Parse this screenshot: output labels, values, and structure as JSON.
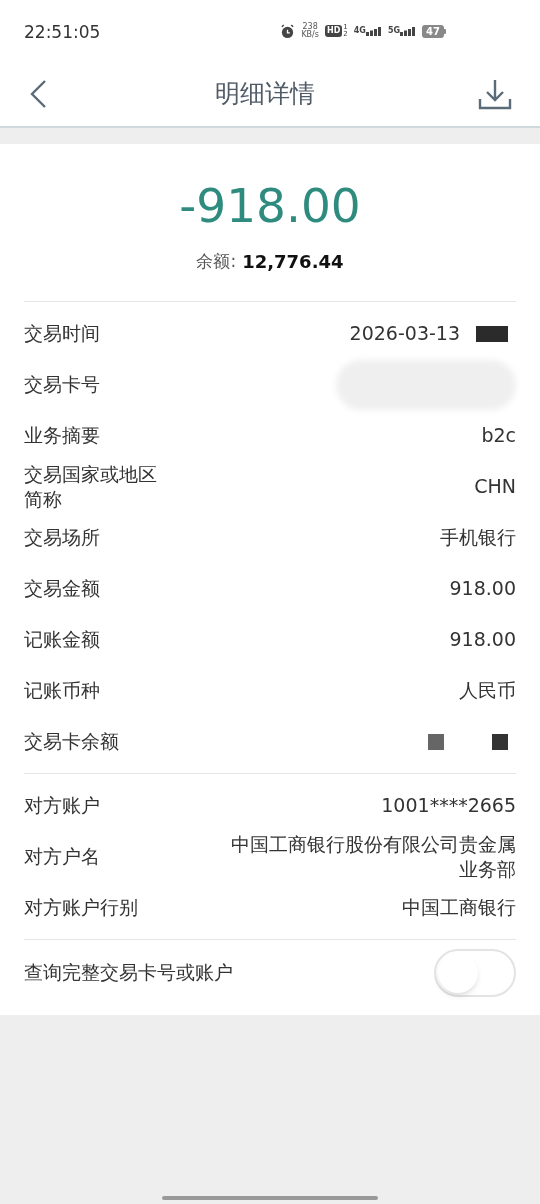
{
  "status_bar": {
    "time": "22:51:05",
    "speed": "238",
    "speed_unit": "KB/s",
    "hd": "HD",
    "sim_1": "1",
    "sim_2": "2",
    "net_1": "4G",
    "net_2": "5G",
    "battery": "47"
  },
  "header": {
    "title": "明细详情"
  },
  "summary": {
    "amount": "-918.00",
    "balance_label": "余额:",
    "balance": "12,776.44"
  },
  "sections": [
    {
      "rows": [
        {
          "label": "交易时间",
          "kind": "date",
          "value": "2026-03-13"
        },
        {
          "label": "交易卡号",
          "kind": "blurred"
        },
        {
          "label": "业务摘要",
          "kind": "text",
          "value": "b2c"
        },
        {
          "label": "交易国家或地区简称",
          "kind": "text",
          "value": "CHN"
        },
        {
          "label": "交易场所",
          "kind": "text",
          "value": "手机银行"
        },
        {
          "label": "交易金额",
          "kind": "text",
          "value": "918.00"
        },
        {
          "label": "记账金额",
          "kind": "text",
          "value": "918.00"
        },
        {
          "label": "记账币种",
          "kind": "text",
          "value": "人民币"
        },
        {
          "label": "交易卡余额",
          "kind": "masked"
        }
      ]
    },
    {
      "rows": [
        {
          "label": "对方账户",
          "kind": "text",
          "value": "1001****2665"
        },
        {
          "label": "对方户名",
          "kind": "text",
          "value": "中国工商银行股份有限公司贵金属业务部"
        },
        {
          "label": "对方账户行别",
          "kind": "text",
          "value": "中国工商银行"
        }
      ]
    }
  ],
  "toggle": {
    "label": "查询完整交易卡号或账户",
    "on": false
  }
}
